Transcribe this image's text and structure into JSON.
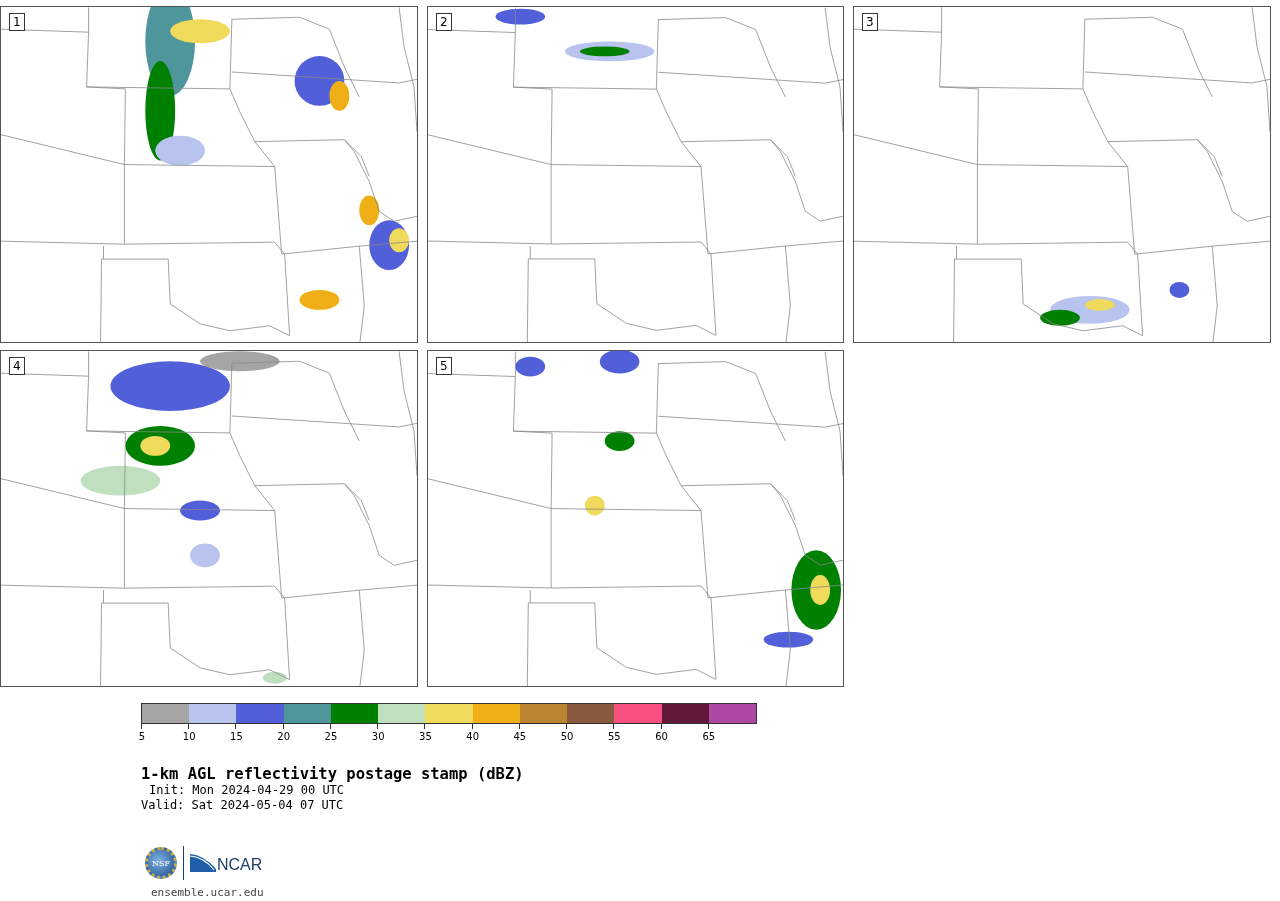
{
  "panels": [
    {
      "label": "1"
    },
    {
      "label": "2"
    },
    {
      "label": "3"
    },
    {
      "label": "4"
    },
    {
      "label": "5"
    }
  ],
  "colorbar": [
    {
      "label": "5",
      "color": "#a5a5a5"
    },
    {
      "label": "10",
      "color": "#b8c4ee"
    },
    {
      "label": "15",
      "color": "#5160d8"
    },
    {
      "label": "20",
      "color": "#4e969b"
    },
    {
      "label": "25",
      "color": "#008000"
    },
    {
      "label": "30",
      "color": "#bfdfbf"
    },
    {
      "label": "35",
      "color": "#f0da5c"
    },
    {
      "label": "40",
      "color": "#f0ae17"
    },
    {
      "label": "45",
      "color": "#bb8431"
    },
    {
      "label": "50",
      "color": "#8a5a3e"
    },
    {
      "label": "55",
      "color": "#f75182"
    },
    {
      "label": "60",
      "color": "#611737"
    },
    {
      "label": "65",
      "color": "#ae48a5"
    }
  ],
  "title": "1-km AGL reflectivity postage stamp (dBZ)",
  "init": "Init: Mon 2024-04-29 00 UTC",
  "valid": "Valid: Sat 2024-05-04 07 UTC",
  "logos": {
    "nsf": "NSF",
    "ncar": "NCAR"
  },
  "site": "ensemble.ucar.edu"
}
